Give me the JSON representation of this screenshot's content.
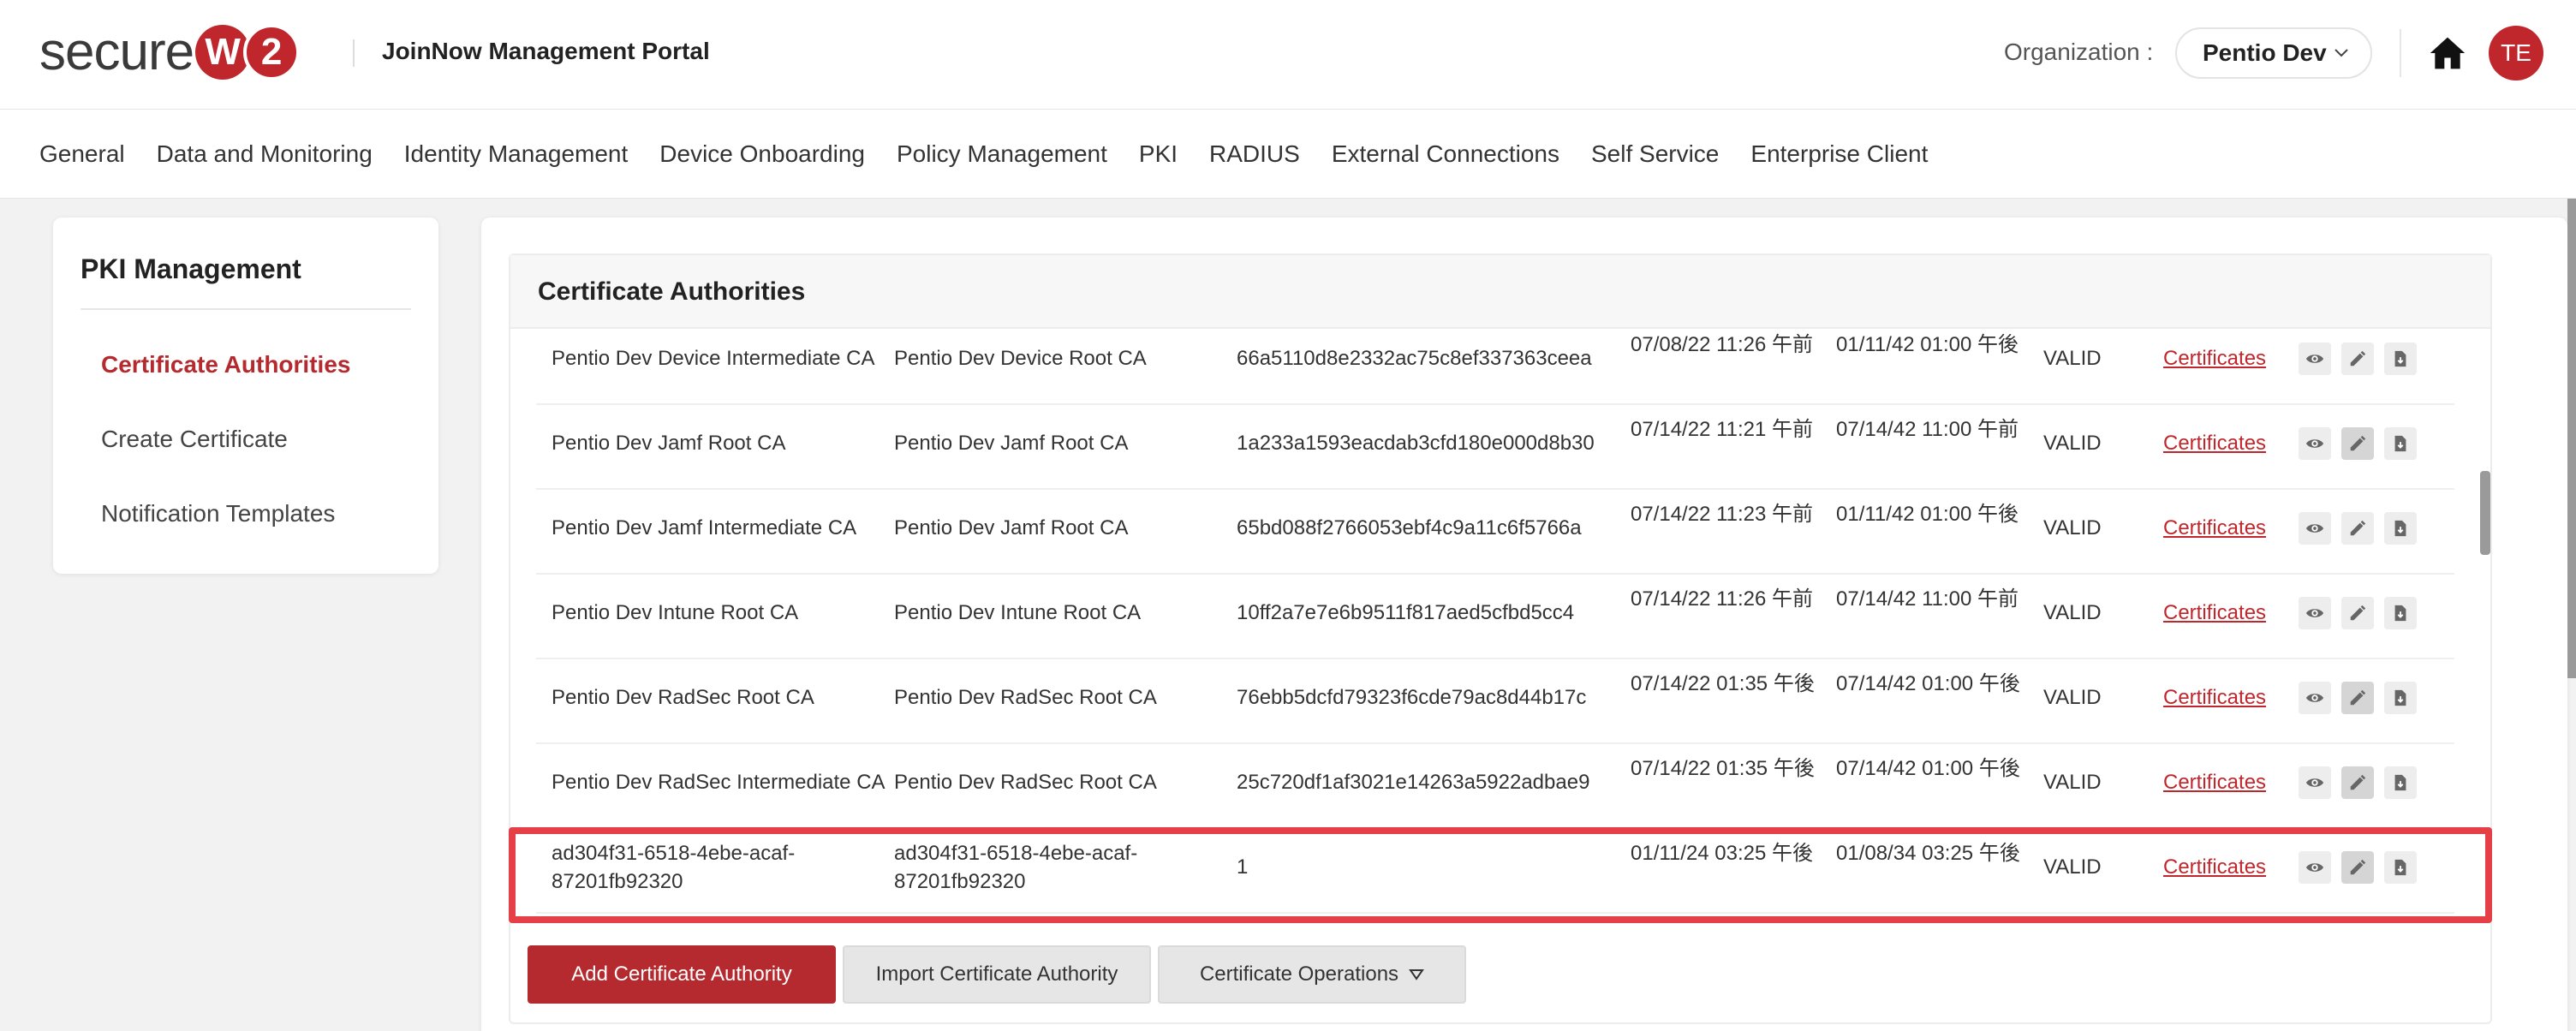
{
  "header": {
    "logo_text": "secure",
    "logo_badge_1": "W",
    "logo_badge_2": "2",
    "portal_title": "JoinNow Management Portal",
    "org_label": "Organization :",
    "org_value": "Pentio Dev",
    "avatar_initials": "TE"
  },
  "nav": {
    "items": [
      "General",
      "Data and Monitoring",
      "Identity Management",
      "Device Onboarding",
      "Policy Management",
      "PKI",
      "RADIUS",
      "External Connections",
      "Self Service",
      "Enterprise Client"
    ]
  },
  "sidebar": {
    "title": "PKI Management",
    "items": [
      {
        "label": "Certificate Authorities",
        "active": true
      },
      {
        "label": "Create Certificate",
        "active": false
      },
      {
        "label": "Notification Templates",
        "active": false
      }
    ]
  },
  "main": {
    "panel_title": "Certificate Authorities",
    "rows": [
      {
        "name": "Pentio Dev Device Intermediate CA",
        "issuer": "Pentio Dev Device Root CA",
        "serial": "66a5110d8e2332ac75c8ef337363ceea",
        "valid_from": "07/08/22 11:26 午前",
        "valid_to": "01/11/42 01:00 午後",
        "status": "VALID",
        "link": "Certificates"
      },
      {
        "name": "Pentio Dev Jamf Root CA",
        "issuer": "Pentio Dev Jamf Root CA",
        "serial": "1a233a1593eacdab3cfd180e000d8b30",
        "valid_from": "07/14/22 11:21 午前",
        "valid_to": "07/14/42 11:00 午前",
        "status": "VALID",
        "link": "Certificates"
      },
      {
        "name": "Pentio Dev Jamf Intermediate CA",
        "issuer": "Pentio Dev Jamf Root CA",
        "serial": "65bd088f2766053ebf4c9a11c6f5766a",
        "valid_from": "07/14/22 11:23 午前",
        "valid_to": "01/11/42 01:00 午後",
        "status": "VALID",
        "link": "Certificates"
      },
      {
        "name": "Pentio Dev Intune Root CA",
        "issuer": "Pentio Dev Intune Root CA",
        "serial": "10ff2a7e7e6b9511f817aed5cfbd5cc4",
        "valid_from": "07/14/22 11:26 午前",
        "valid_to": "07/14/42 11:00 午前",
        "status": "VALID",
        "link": "Certificates"
      },
      {
        "name": "Pentio Dev RadSec Root CA",
        "issuer": "Pentio Dev RadSec Root CA",
        "serial": "76ebb5dcfd79323f6cde79ac8d44b17c",
        "valid_from": "07/14/22 01:35 午後",
        "valid_to": "07/14/42 01:00 午後",
        "status": "VALID",
        "link": "Certificates"
      },
      {
        "name": "Pentio Dev RadSec Intermediate CA",
        "issuer": "Pentio Dev RadSec Root CA",
        "serial": "25c720df1af3021e14263a5922adbae9",
        "valid_from": "07/14/22 01:35 午後",
        "valid_to": "07/14/42 01:00 午後",
        "status": "VALID",
        "link": "Certificates"
      },
      {
        "name": "ad304f31-6518-4ebe-acaf-87201fb92320",
        "issuer": "ad304f31-6518-4ebe-acaf-87201fb92320",
        "serial": "1",
        "valid_from": "01/11/24 03:25 午後",
        "valid_to": "01/08/34 03:25 午後",
        "status": "VALID",
        "link": "Certificates"
      }
    ],
    "buttons": {
      "add": "Add Certificate Authority",
      "import": "Import Certificate Authority",
      "operations": "Certificate Operations"
    }
  },
  "colors": {
    "brand": "#c0272d",
    "highlight": "#e53f47"
  }
}
